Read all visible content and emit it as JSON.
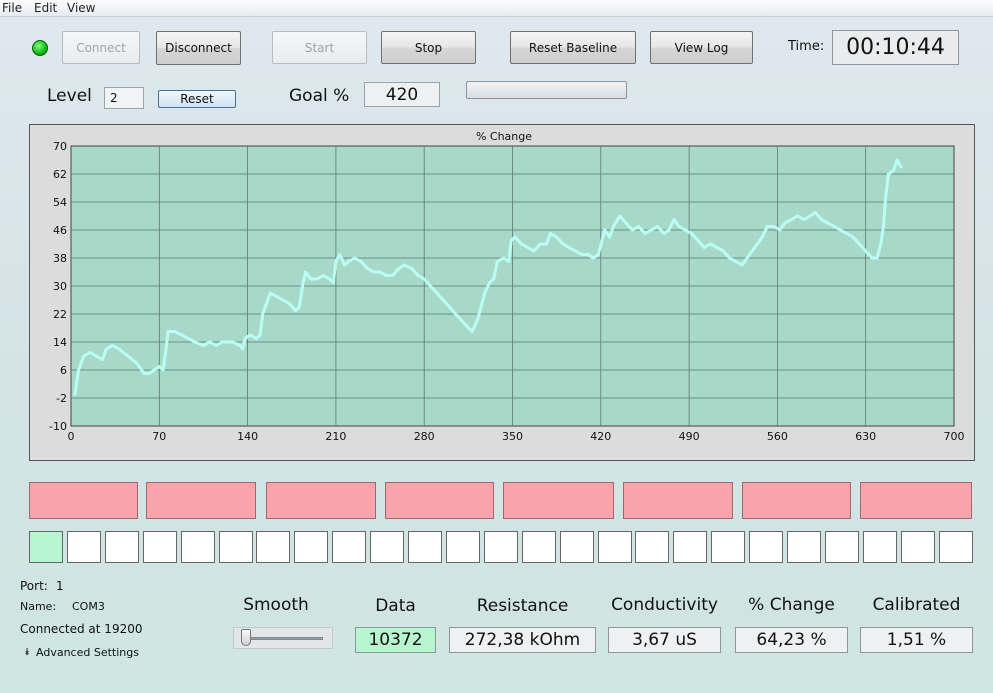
{
  "menu": [
    "File",
    "Edit",
    "View"
  ],
  "toolbar": {
    "connect": "Connect",
    "disconnect": "Disconnect",
    "start": "Start",
    "stop": "Stop",
    "reset_baseline": "Reset Baseline",
    "view_log": "View Log",
    "time_label": "Time:",
    "time_value": "00:10:44"
  },
  "level": {
    "label": "Level",
    "value": "2",
    "reset": "Reset"
  },
  "goal": {
    "label": "Goal %",
    "value": "420",
    "progress": 0
  },
  "colors": {
    "plot_bg": "#a8d8c8",
    "series": "#b9fff6",
    "pink": "#f9a3ac",
    "active_square": "#b6f5cf",
    "led": "#14b814"
  },
  "chart_data": {
    "type": "line",
    "title": "% Change",
    "xlabel": "",
    "ylabel": "",
    "xlim": [
      0,
      700
    ],
    "ylim": [
      -10,
      70
    ],
    "x_ticks": [
      "0",
      "70",
      "140",
      "210",
      "280",
      "350",
      "420",
      "490",
      "560",
      "630",
      "700"
    ],
    "y_ticks": [
      "70",
      "62",
      "54",
      "46",
      "38",
      "30",
      "22",
      "14",
      "6",
      "-2",
      "-10"
    ],
    "grid": true,
    "series": [
      {
        "name": "",
        "points": [
          [
            3,
            -1
          ],
          [
            6,
            6
          ],
          [
            10,
            10
          ],
          [
            15,
            11
          ],
          [
            20,
            10
          ],
          [
            25,
            9
          ],
          [
            28,
            12
          ],
          [
            33,
            13
          ],
          [
            38,
            12
          ],
          [
            45,
            10
          ],
          [
            52,
            8
          ],
          [
            58,
            5
          ],
          [
            62,
            5
          ],
          [
            66,
            6
          ],
          [
            70,
            7
          ],
          [
            73,
            6
          ],
          [
            75,
            11
          ],
          [
            77,
            17
          ],
          [
            82,
            17
          ],
          [
            88,
            16
          ],
          [
            93,
            15
          ],
          [
            98,
            14
          ],
          [
            105,
            13
          ],
          [
            110,
            14
          ],
          [
            115,
            13
          ],
          [
            120,
            14
          ],
          [
            128,
            14
          ],
          [
            134,
            13
          ],
          [
            136,
            12
          ],
          [
            138,
            15
          ],
          [
            142,
            16
          ],
          [
            147,
            15
          ],
          [
            150,
            16
          ],
          [
            152,
            22
          ],
          [
            155,
            25
          ],
          [
            158,
            28
          ],
          [
            163,
            27
          ],
          [
            168,
            26
          ],
          [
            173,
            25
          ],
          [
            178,
            23
          ],
          [
            181,
            24
          ],
          [
            184,
            31
          ],
          [
            186,
            34
          ],
          [
            190,
            32
          ],
          [
            195,
            32
          ],
          [
            200,
            33
          ],
          [
            205,
            32
          ],
          [
            208,
            31
          ],
          [
            210,
            37
          ],
          [
            213,
            39
          ],
          [
            217,
            36
          ],
          [
            220,
            37
          ],
          [
            225,
            38
          ],
          [
            230,
            37
          ],
          [
            235,
            35
          ],
          [
            240,
            34
          ],
          [
            245,
            34
          ],
          [
            250,
            33
          ],
          [
            255,
            33
          ],
          [
            260,
            35
          ],
          [
            264,
            36
          ],
          [
            270,
            35
          ],
          [
            275,
            33
          ],
          [
            280,
            32
          ],
          [
            285,
            30
          ],
          [
            290,
            28
          ],
          [
            295,
            26
          ],
          [
            300,
            24
          ],
          [
            305,
            22
          ],
          [
            310,
            20
          ],
          [
            315,
            18
          ],
          [
            318,
            17
          ],
          [
            322,
            20
          ],
          [
            325,
            24
          ],
          [
            328,
            28
          ],
          [
            332,
            31
          ],
          [
            335,
            32
          ],
          [
            338,
            37
          ],
          [
            343,
            38
          ],
          [
            347,
            37
          ],
          [
            349,
            43
          ],
          [
            352,
            44
          ],
          [
            357,
            42
          ],
          [
            362,
            41
          ],
          [
            367,
            40
          ],
          [
            372,
            42
          ],
          [
            377,
            42
          ],
          [
            380,
            45
          ],
          [
            385,
            44
          ],
          [
            390,
            42
          ],
          [
            395,
            41
          ],
          [
            400,
            40
          ],
          [
            405,
            39
          ],
          [
            410,
            39
          ],
          [
            414,
            38
          ],
          [
            418,
            39
          ],
          [
            421,
            43
          ],
          [
            423,
            46
          ],
          [
            427,
            44
          ],
          [
            430,
            47
          ],
          [
            435,
            50
          ],
          [
            440,
            48
          ],
          [
            445,
            46
          ],
          [
            450,
            47
          ],
          [
            455,
            45
          ],
          [
            460,
            46
          ],
          [
            465,
            47
          ],
          [
            470,
            45
          ],
          [
            474,
            46
          ],
          [
            478,
            49
          ],
          [
            482,
            47
          ],
          [
            487,
            46
          ],
          [
            492,
            45
          ],
          [
            497,
            43
          ],
          [
            502,
            41
          ],
          [
            507,
            42
          ],
          [
            512,
            41
          ],
          [
            517,
            40
          ],
          [
            522,
            38
          ],
          [
            527,
            37
          ],
          [
            532,
            36
          ],
          [
            536,
            38
          ],
          [
            540,
            40
          ],
          [
            544,
            42
          ],
          [
            548,
            44
          ],
          [
            552,
            47
          ],
          [
            557,
            47
          ],
          [
            562,
            46
          ],
          [
            566,
            48
          ],
          [
            571,
            49
          ],
          [
            576,
            50
          ],
          [
            581,
            49
          ],
          [
            586,
            50
          ],
          [
            590,
            51
          ],
          [
            595,
            49
          ],
          [
            600,
            48
          ],
          [
            605,
            47
          ],
          [
            610,
            46
          ],
          [
            615,
            45
          ],
          [
            620,
            44
          ],
          [
            625,
            42
          ],
          [
            630,
            40
          ],
          [
            635,
            38
          ],
          [
            639,
            38
          ],
          [
            642,
            42
          ],
          [
            644,
            47
          ],
          [
            646,
            56
          ],
          [
            648,
            62
          ],
          [
            652,
            63
          ],
          [
            655,
            66
          ],
          [
            658,
            64
          ]
        ]
      }
    ]
  },
  "cells": {
    "pink_count": 8,
    "square_count": 25,
    "active_square_index": 0
  },
  "info": {
    "port_label": "Port:",
    "port_value": "1",
    "name_label": "Name:",
    "name_value": "COM3",
    "connected": "Connected at 19200",
    "advanced": "Advanced Settings"
  },
  "smooth": {
    "label": "Smooth",
    "level": 0
  },
  "stats": [
    {
      "label": "Data",
      "value": "10372"
    },
    {
      "label": "Resistance",
      "value": "272,38 kOhm"
    },
    {
      "label": "Conductivity",
      "value": "3,67 uS"
    },
    {
      "label": "% Change",
      "value": "64,23 %"
    },
    {
      "label": "Calibrated",
      "value": "1,51 %"
    }
  ]
}
